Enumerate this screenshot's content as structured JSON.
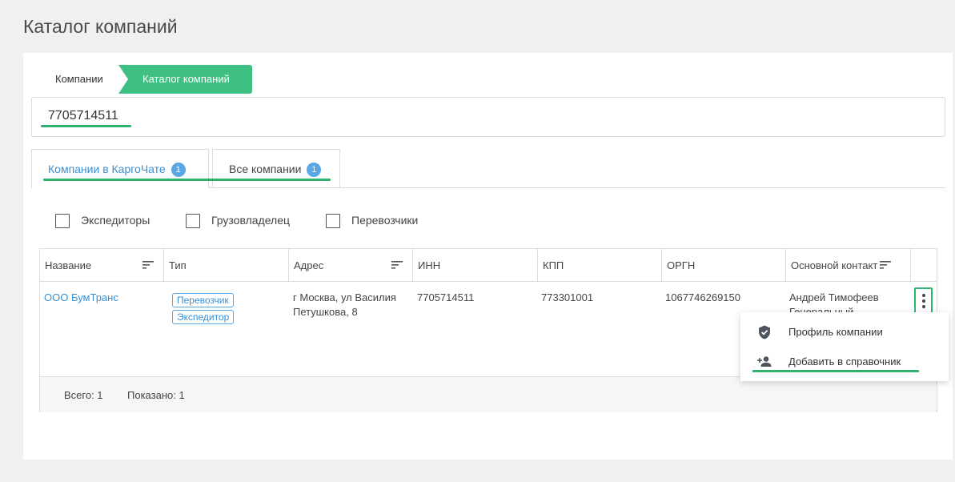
{
  "page": {
    "title": "Каталог компаний"
  },
  "breadcrumb": {
    "items": [
      "Компании",
      "Каталог компаний"
    ]
  },
  "search": {
    "value": "7705714511"
  },
  "tabs": [
    {
      "label": "Компании в КаргоЧате",
      "count": "1"
    },
    {
      "label": "Все компании",
      "count": "1"
    }
  ],
  "filters": [
    "Экспедиторы",
    "Грузовладелец",
    "Перевозчики"
  ],
  "table": {
    "columns": [
      "Название",
      "Тип",
      "Адрес",
      "ИНН",
      "КПП",
      "ОРГН",
      "Основной контакт"
    ],
    "row": {
      "name": "ООО БумТранс",
      "types": [
        "Перевозчик",
        "Экспедитор"
      ],
      "address": "г Москва, ул Василия Петушкова, 8",
      "inn": "7705714511",
      "kpp": "773301001",
      "ogrn": "1067746269150",
      "contact_name": "Андрей Тимофеев",
      "contact_role": "Генеральный"
    },
    "footer": {
      "total": "Всего: 1",
      "shown": "Показано: 1"
    }
  },
  "menu": {
    "items": [
      {
        "label": "Профиль компании",
        "icon": "shield-check-icon"
      },
      {
        "label": "Добавить в справочник",
        "icon": "person-add-icon"
      }
    ]
  },
  "colors": {
    "accent_green": "#3fbf82",
    "link_blue": "#3a8fd0",
    "badge_blue": "#5aa7e6",
    "highlight_green": "#2fb36e"
  }
}
